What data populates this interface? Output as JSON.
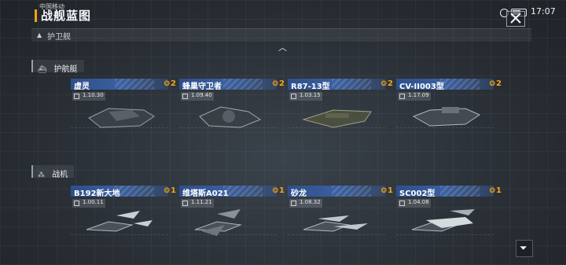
{
  "header": {
    "title": "战舰蓝图",
    "status_left": "中国移动",
    "time": "17:07"
  },
  "sections": {
    "frigate_label": "护卫舰",
    "escort_label": "护航艇",
    "fighter_label": "战机"
  },
  "escort_ships": [
    {
      "name": "虚灵",
      "level": "2",
      "stat": "1.10.30"
    },
    {
      "name": "蜂巢守卫者",
      "level": "2",
      "stat": "1.09.40"
    },
    {
      "name": "R87-13型",
      "level": "2",
      "stat": "1.03.15"
    },
    {
      "name": "CV-II003型",
      "level": "2",
      "stat": "1.17.09"
    }
  ],
  "fighter_ships": [
    {
      "name": "B192新大地",
      "level": "1",
      "stat": "1.00.11"
    },
    {
      "name": "维塔斯A021",
      "level": "1",
      "stat": "1.11.21"
    },
    {
      "name": "砂龙",
      "level": "1",
      "stat": "1.08.32"
    },
    {
      "name": "SC002型",
      "level": "1",
      "stat": "1.04.08"
    }
  ],
  "colors": {
    "accent": "#f0a21a",
    "name_bar": "#3a5fa0",
    "level": "#f3a619"
  },
  "icons": {
    "close": "close-icon",
    "filter": "filter-icon",
    "chevron": "chevron-up-icon"
  }
}
